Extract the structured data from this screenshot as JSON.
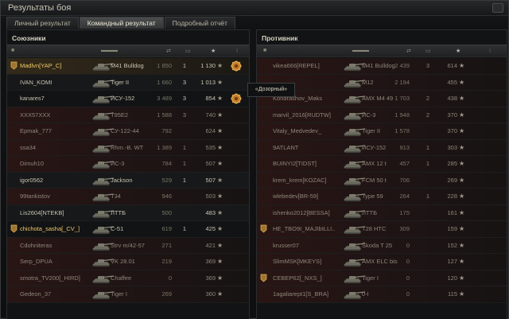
{
  "window": {
    "title": "Результаты боя"
  },
  "tabs": [
    {
      "label": "Личный результат",
      "active": false
    },
    {
      "label": "Командный результат",
      "active": true
    },
    {
      "label": "Подробный отчёт",
      "active": false
    }
  ],
  "allies": {
    "title": "Союзники",
    "rows": [
      {
        "name": "Madlvn[YAP_C]",
        "tank": "M41 Bulldog",
        "sv": "1 850",
        "kills": "1",
        "xp": "1 130",
        "dead": false,
        "me": true,
        "rank_icon": true,
        "medal": true
      },
      {
        "name": "IVAN_KOMI",
        "tank": "Tiger II",
        "sv": "1 660",
        "kills": "3",
        "xp": "1 013",
        "dead": false
      },
      {
        "name": "kanares7",
        "tank": "ИСУ-152",
        "sv": "3 489",
        "kills": "3",
        "xp": "854",
        "dead": false,
        "medal": true
      },
      {
        "name": "XXX57XXX",
        "tank": "T95E2",
        "sv": "1 588",
        "kills": "3",
        "xp": "740",
        "dead": true
      },
      {
        "name": "Epmak_777",
        "tank": "СУ-122-44",
        "sv": "792",
        "kills": "",
        "xp": "624",
        "dead": true
      },
      {
        "name": "ssa34",
        "tank": "Rhm.-B. WT",
        "sv": "1 389",
        "kills": "1",
        "xp": "535",
        "dead": true
      },
      {
        "name": "Dimuh10",
        "tank": "ИС-3",
        "sv": "784",
        "kills": "1",
        "xp": "507",
        "dead": true
      },
      {
        "name": "igor0562",
        "tank": "Jackson",
        "sv": "529",
        "kills": "1",
        "xp": "507",
        "dead": false
      },
      {
        "name": "99tankistov",
        "tank": "T34",
        "sv": "946",
        "kills": "",
        "xp": "503",
        "dead": true
      },
      {
        "name": "Lis2604[NTEKB]",
        "tank": "ЛТТБ",
        "sv": "500",
        "kills": "",
        "xp": "483",
        "dead": false
      },
      {
        "name": "chichota_sasha[_CV_]",
        "tank": "С-51",
        "sv": "619",
        "kills": "1",
        "xp": "425",
        "dead": false,
        "rank_icon": true,
        "highlight": true
      },
      {
        "name": "Cdohniteras",
        "tank": "Strv m/42-57",
        "sv": "271",
        "kills": "",
        "xp": "421",
        "dead": true
      },
      {
        "name": "Serp_DPUA",
        "tank": "VK 28.01",
        "sv": "219",
        "kills": "",
        "xp": "369",
        "dead": true
      },
      {
        "name": "smotra_TV200[_HIRD]",
        "tank": "Chaffee",
        "sv": "0",
        "kills": "",
        "xp": "369",
        "dead": true
      },
      {
        "name": "Gedeon_37",
        "tank": "Tiger I",
        "sv": "269",
        "kills": "",
        "xp": "360",
        "dead": true
      }
    ]
  },
  "enemies": {
    "title": "Противник",
    "rows": [
      {
        "name": "vikea666[REPEL]",
        "tank": "M41 Bulldog",
        "sv": "2 439",
        "kills": "3",
        "xp": "614",
        "dead": true
      },
      {
        "name": "",
        "tank": "M12",
        "sv": "2 194",
        "kills": "",
        "xp": "455",
        "dead": true
      },
      {
        "name": "Kondrashov_Maks",
        "tank": "AMX M4 49",
        "sv": "1 703",
        "kills": "2",
        "xp": "438",
        "dead": true
      },
      {
        "name": "marvil_2016[RUDTW]",
        "tank": "ИС-3",
        "sv": "1 948",
        "kills": "2",
        "xp": "370",
        "dead": true
      },
      {
        "name": "Vitaly_Medvedev_",
        "tank": "Tiger II",
        "sv": "1 578",
        "kills": "",
        "xp": "370",
        "dead": true
      },
      {
        "name": "9ATLANT",
        "tank": "ИСУ-152",
        "sv": "913",
        "kills": "1",
        "xp": "303",
        "dead": true
      },
      {
        "name": "BUINYI2[TIDST]",
        "tank": "AMX 12 t",
        "sv": "457",
        "kills": "1",
        "xp": "285",
        "dead": true
      },
      {
        "name": "krem_krem[KOZAC]",
        "tank": "FCM 50 t",
        "sv": "706",
        "kills": "",
        "xp": "269",
        "dead": true
      },
      {
        "name": "wlebedev[BR-59]",
        "tank": "Type 59",
        "sv": "264",
        "kills": "1",
        "xp": "228",
        "dead": true
      },
      {
        "name": "ishenko2012[BESSA]",
        "tank": "ЛТТБ",
        "sv": "175",
        "kills": "",
        "xp": "161",
        "dead": true
      },
      {
        "name": "HE_TBO9I_MAJIbILLI..",
        "tank": "T28 HTC",
        "sv": "309",
        "kills": "",
        "xp": "159",
        "dead": true,
        "rank_icon": true
      },
      {
        "name": "krusser07",
        "tank": "Škoda T 25",
        "sv": "0",
        "kills": "",
        "xp": "152",
        "dead": true
      },
      {
        "name": "SlimMSK[MKEYS]",
        "tank": "AMX ELC bis",
        "sv": "0",
        "kills": "",
        "xp": "127",
        "dead": true
      },
      {
        "name": "CEBEP62[_NXS_]",
        "tank": "Tiger I",
        "sv": "0",
        "kills": "",
        "xp": "120",
        "dead": true,
        "rank_icon": true
      },
      {
        "name": "1agaliarept1[S_BRA]",
        "tank": "0-I",
        "sv": "0",
        "kills": "",
        "xp": "115",
        "dead": true
      }
    ]
  },
  "tooltip": {
    "text": "«Дозорный»"
  },
  "colors": {
    "accent": "#e4c067",
    "dead_row": "#3c1410"
  }
}
